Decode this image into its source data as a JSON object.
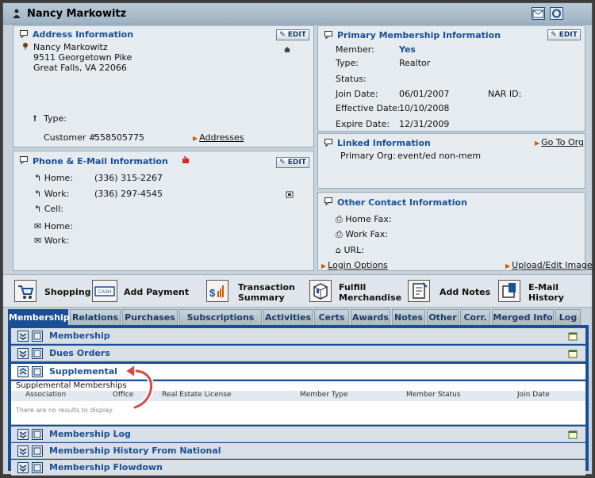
{
  "header": {
    "name": "Nancy Markowitz"
  },
  "address": {
    "title": "Address Information",
    "edit_label": "EDIT",
    "name": "Nancy Markowitz",
    "street": "9511 Georgetown Pike",
    "city": "Great Falls, VA 22066",
    "type_label": "Type:",
    "customer_label": "Customer #:",
    "customer_no": "558505775",
    "addresses_link": "Addresses"
  },
  "phone": {
    "title": "Phone & E-Mail Information",
    "edit_label": "EDIT",
    "home_label": "Home:",
    "home_value": "(336) 315-2267",
    "work_label": "Work:",
    "work_value": "(336) 297-4545",
    "cell_label": "Cell:",
    "email_home_label": "Home:",
    "email_work_label": "Work:"
  },
  "membership": {
    "title": "Primary Membership Information",
    "edit_label": "EDIT",
    "member_label": "Member:",
    "member_value": "Yes",
    "type_label": "Type:",
    "type_value": "Realtor",
    "status_label": "Status:",
    "join_label": "Join Date:",
    "join_value": "06/01/2007",
    "nar_label": "NAR ID:",
    "effective_label": "Effective Date:",
    "effective_value": "10/10/2008",
    "expire_label": "Expire Date:",
    "expire_value": "12/31/2009"
  },
  "linked": {
    "title": "Linked Information",
    "goto_link": "Go To Org",
    "primary_org_label": "Primary Org:",
    "primary_org_value": "event/ed non-mem"
  },
  "other_contact": {
    "title": "Other Contact Information",
    "home_fax_label": "Home Fax:",
    "work_fax_label": "Work Fax:",
    "url_label": "URL:",
    "login_link": "Login Options",
    "upload_link": "Upload/Edit Image"
  },
  "toolbar": {
    "shopping": "Shopping",
    "add_payment": "Add Payment",
    "transaction_1": "Transaction",
    "transaction_2": "Summary",
    "fulfill_1": "Fulfill",
    "fulfill_2": "Merchandise",
    "add_notes": "Add Notes",
    "email_1": "E-Mail",
    "email_2": "History"
  },
  "tabs": [
    "Membership",
    "Relations",
    "Purchases",
    "Subscriptions",
    "Activities",
    "Certs",
    "Awards",
    "Notes",
    "Other",
    "Corr.",
    "Merged Info",
    "Log"
  ],
  "sections": {
    "s1": "Membership",
    "s2": "Dues Orders",
    "s3": "Supplemental",
    "s4": "Membership Log",
    "s5": "Membership History From National",
    "s6": "Membership Flowdown"
  },
  "supplemental": {
    "caption": "Supplemental Memberships",
    "columns": [
      "Association",
      "Office",
      "Real Estate License",
      "Member Type",
      "Member Status",
      "Join Date"
    ],
    "empty": "There are no results to display."
  },
  "colors": {
    "accent": "#1a4f96",
    "arrow": "#d05a00"
  }
}
